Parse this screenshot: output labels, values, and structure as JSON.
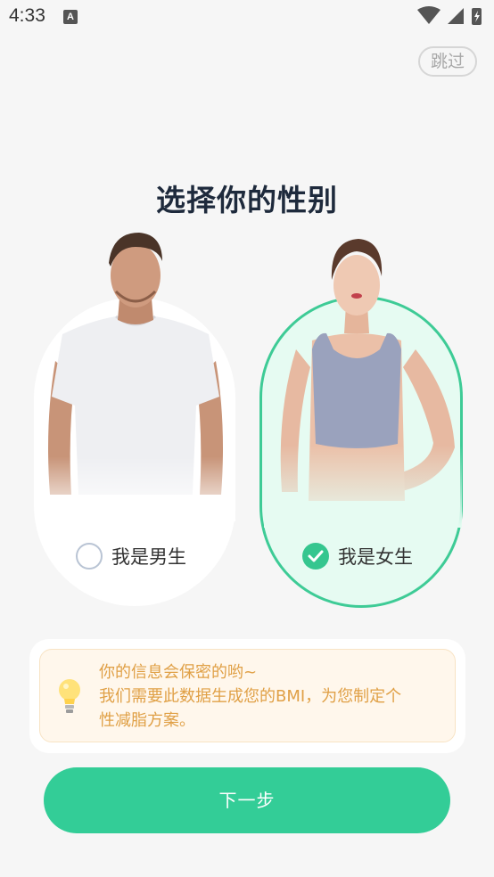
{
  "status_bar": {
    "time": "4:33",
    "notification_letter": "A"
  },
  "skip_label": "跳过",
  "title": "选择你的性别",
  "options": [
    {
      "label": "我是男生",
      "selected": false
    },
    {
      "label": "我是女生",
      "selected": true
    }
  ],
  "info": {
    "line1": "你的信息会保密的哟~",
    "line2": "我们需要此数据生成您的BMI，为您制定个",
    "line3": "性减脂方案。"
  },
  "next_label": "下一步",
  "colors": {
    "accent": "#33cd97",
    "info_text": "#e0a046",
    "title": "#1e2a3c"
  }
}
